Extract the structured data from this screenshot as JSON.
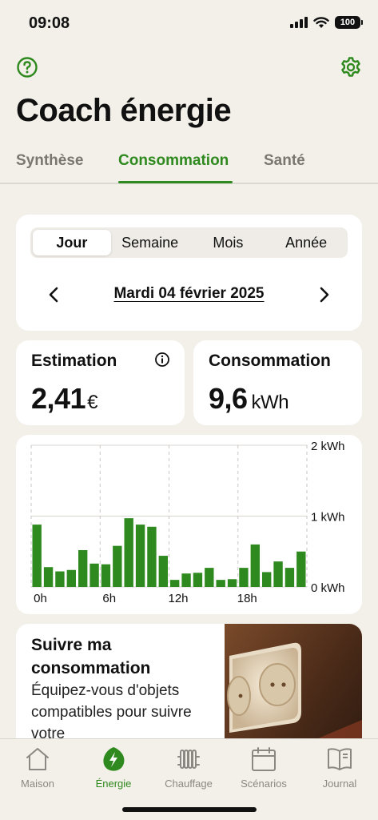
{
  "status_bar": {
    "time": "09:08",
    "battery": "100"
  },
  "header": {
    "title": "Coach énergie"
  },
  "tabs": [
    {
      "label": "Synthèse",
      "active": false
    },
    {
      "label": "Consommation",
      "active": true
    },
    {
      "label": "Santé",
      "active": false
    }
  ],
  "period": {
    "options": [
      "Jour",
      "Semaine",
      "Mois",
      "Année"
    ],
    "selected": "Jour",
    "date": "Mardi 04 février 2025"
  },
  "estimation": {
    "label": "Estimation",
    "value": "2,41",
    "unit": "€"
  },
  "consumption": {
    "label": "Consommation",
    "value": "9,6",
    "unit": "kWh"
  },
  "chart_data": {
    "type": "bar",
    "x_tick_labels": [
      "0h",
      "6h",
      "12h",
      "18h"
    ],
    "y_tick_labels": [
      "2 kWh",
      "1 kWh",
      "0 kWh"
    ],
    "ylim": [
      0,
      2
    ],
    "categories": [
      "0h",
      "1h",
      "2h",
      "3h",
      "4h",
      "5h",
      "6h",
      "7h",
      "8h",
      "9h",
      "10h",
      "11h",
      "12h",
      "13h",
      "14h",
      "15h",
      "16h",
      "17h",
      "18h",
      "19h",
      "20h",
      "21h",
      "22h",
      "23h"
    ],
    "values": [
      0.88,
      0.28,
      0.22,
      0.24,
      0.52,
      0.33,
      0.32,
      0.58,
      0.97,
      0.88,
      0.85,
      0.44,
      0.1,
      0.19,
      0.2,
      0.27,
      0.1,
      0.11,
      0.27,
      0.6,
      0.21,
      0.36,
      0.27,
      0.5
    ],
    "bar_color": "#2e8a1e",
    "grid": true
  },
  "promo": {
    "title": "Suivre ma consommation",
    "text": "Équipez-vous d'objets compatibles pour suivre votre"
  },
  "tabbar": [
    {
      "label": "Maison",
      "icon": "house-icon",
      "active": false
    },
    {
      "label": "Énergie",
      "icon": "energy-leaf-icon",
      "active": true
    },
    {
      "label": "Chauffage",
      "icon": "radiator-icon",
      "active": false
    },
    {
      "label": "Scénarios",
      "icon": "calendar-icon",
      "active": false
    },
    {
      "label": "Journal",
      "icon": "journal-icon",
      "active": false
    }
  ],
  "colors": {
    "accent": "#2e8a1e",
    "background": "#f3efe9",
    "card": "#ffffff",
    "muted": "#7a7670"
  }
}
